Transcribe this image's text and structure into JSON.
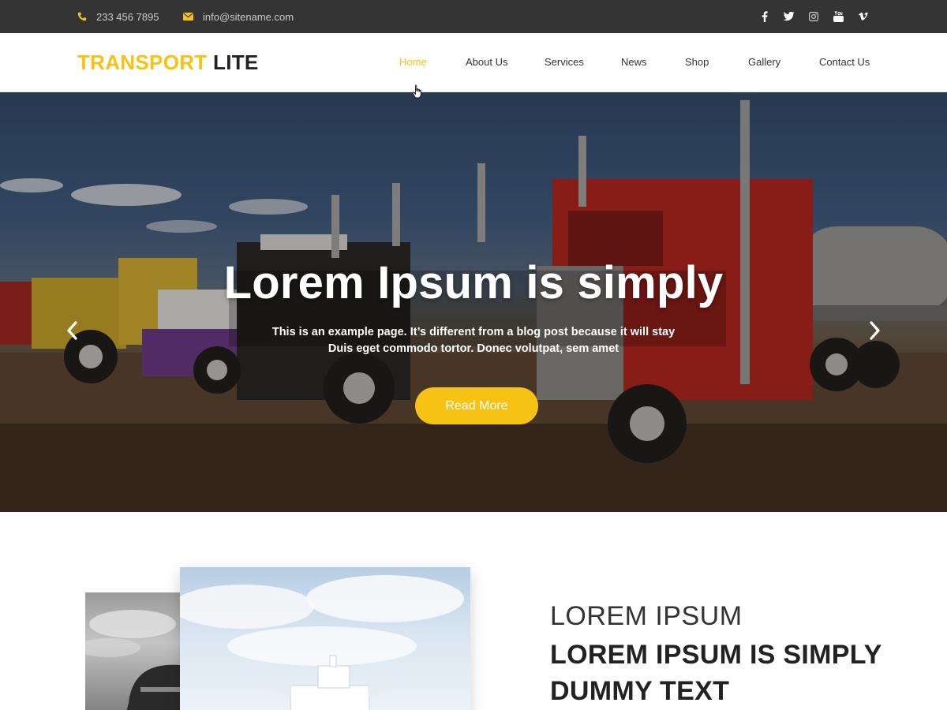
{
  "topbar": {
    "phone": "233 456 7895",
    "email": "info@sitename.com",
    "phone_icon": "phone-icon",
    "email_icon": "envelope-icon",
    "social_icons": [
      "facebook-icon",
      "twitter-icon",
      "instagram-icon",
      "youtube-icon",
      "vimeo-icon"
    ],
    "accent_color": "#f6c213",
    "background": "#343434"
  },
  "header": {
    "logo_part1": "TRANSPORT",
    "logo_part2": "LITE",
    "nav": [
      "Home",
      "About Us",
      "Services",
      "News",
      "Shop",
      "Gallery",
      "Contact Us"
    ],
    "active_nav": "Home"
  },
  "hero": {
    "title": "Lorem Ipsum is simply",
    "subtitle_line1": "This is an example page. It’s different from a blog post because it will stay",
    "subtitle_line2": "Duis eget commodo tortor. Donec volutpat, sem amet",
    "button_label": "Read More",
    "prev_icon": "chevron-left-icon",
    "next_icon": "chevron-right-icon"
  },
  "about": {
    "kicker": "LOREM IPSUM",
    "headline_line1": "LOREM IPSUM IS SIMPLY",
    "headline_line2": "DUMMY TEXT"
  }
}
